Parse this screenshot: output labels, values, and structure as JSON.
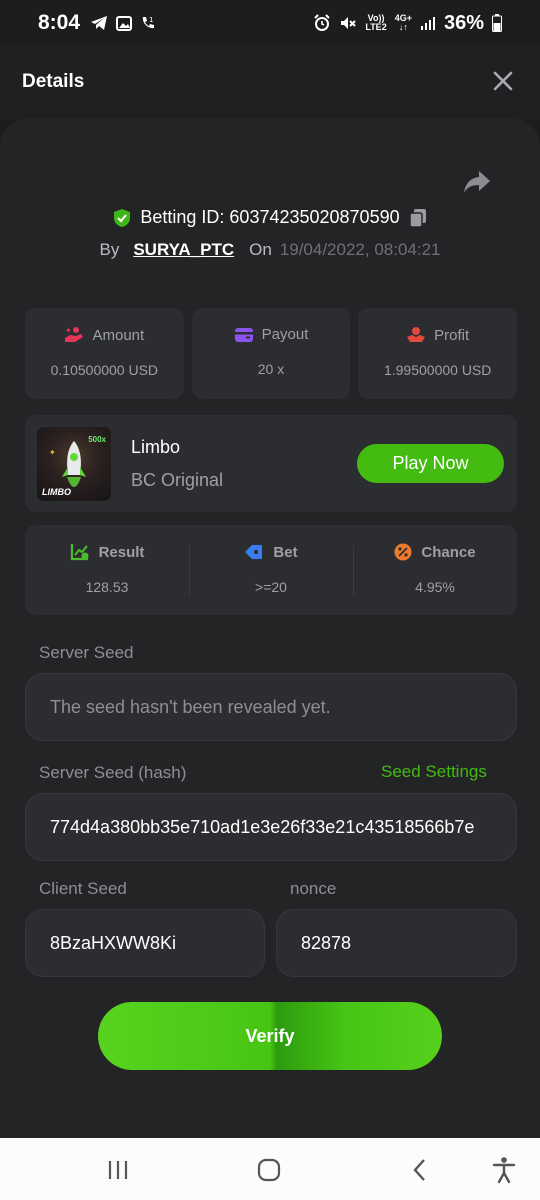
{
  "status_bar": {
    "time": "8:04",
    "network_top": "Vo))",
    "network_bottom": "LTE2",
    "mobile_top": "4G+",
    "battery": "36%"
  },
  "header": {
    "title": "Details"
  },
  "bet": {
    "id_label": "Betting ID: 60374235020870590",
    "by_label": "By",
    "user": "SURYA_PTC",
    "on_label": "On",
    "datetime": "19/04/2022, 08:04:21"
  },
  "stats": [
    {
      "label": "Amount",
      "value": "0.10500000 USD",
      "icon": "hand-coins-icon",
      "color": "#e5345a"
    },
    {
      "label": "Payout",
      "value": "20 x",
      "icon": "wallet-icon",
      "color": "#8a55ef"
    },
    {
      "label": "Profit",
      "value": "1.99500000 USD",
      "icon": "hand-profit-icon",
      "color": "#e44a3e"
    }
  ],
  "game": {
    "name": "Limbo",
    "provider": "BC Original",
    "thumb_text": "LIMBO",
    "thumb_multiplier": "500x",
    "play_label": "Play Now"
  },
  "result": [
    {
      "label": "Result",
      "value": "128.53",
      "icon": "chart-check-icon",
      "color": "#4cba2b"
    },
    {
      "label": "Bet",
      "value": ">=20",
      "icon": "tag-icon",
      "color": "#3a7df2"
    },
    {
      "label": "Chance",
      "value": "4.95%",
      "icon": "percent-icon",
      "color": "#ee7b2c"
    }
  ],
  "fields": {
    "server_seed_label": "Server Seed",
    "server_seed_value": "The seed hasn't been revealed yet.",
    "hash_label": "Server Seed (hash)",
    "seed_settings": "Seed Settings",
    "hash_value": "774d4a380bb35e710ad1e3e26f33e21c43518566b7e",
    "client_seed_label": "Client Seed",
    "client_seed_value": "8BzaHXWW8Ki",
    "nonce_label": "nonce",
    "nonce_value": "82878"
  },
  "verify_label": "Verify",
  "colors": {
    "accent_green": "#43bb10",
    "panel": "#232426",
    "card": "#2c2d30"
  }
}
